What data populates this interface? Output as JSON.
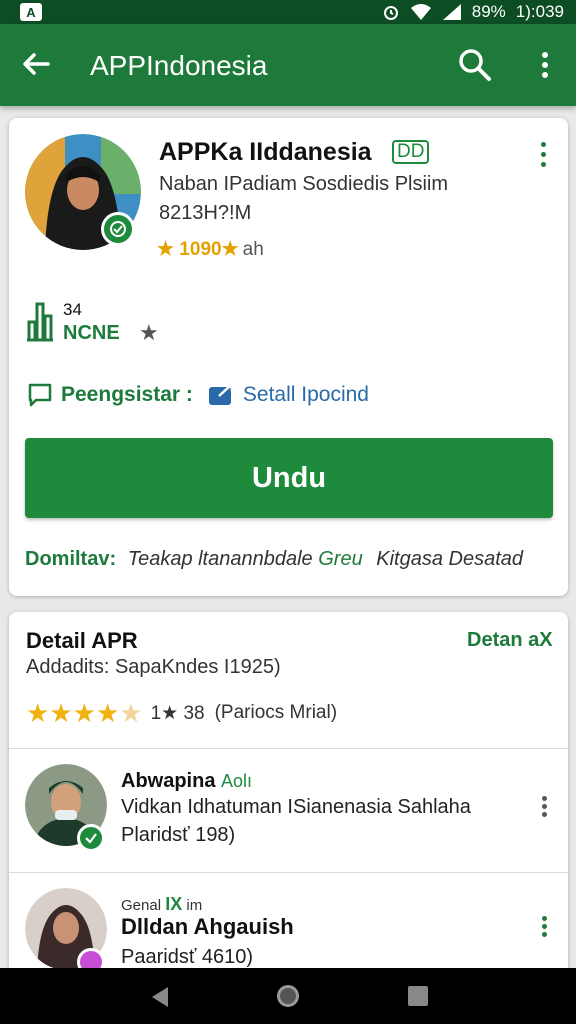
{
  "status_bar": {
    "app_icon": "A",
    "battery": "89%",
    "time": "1):039",
    "icons": [
      "alarm-icon",
      "wifi-icon",
      "signal-icon",
      "battery-icon"
    ]
  },
  "app_bar": {
    "title": "APPIndonesia",
    "icons": [
      "back-arrow-icon",
      "search-icon",
      "more-vert-icon"
    ]
  },
  "app_card": {
    "title": "APPKa IIddanesia",
    "badge": "DD",
    "subtitle": "Naban IPadiam Sosdiedis Plsiim",
    "code": "8213H?!M",
    "rating_text": "★ 1090★",
    "rating_suffix": "ah",
    "metric_number": "34",
    "metric_label": "NCNE",
    "register_label": "Peengsistar :",
    "register_value": "Setall Ipocind",
    "install_label": "Undu",
    "info_key": "Domiltav:",
    "info_value_1": "Teakap ltanannbdale",
    "info_value_2": "Greu",
    "info_value_3": "Kitgasa Desatad",
    "colors": {
      "primary": "#1d8a3c",
      "link": "#2a6aa8",
      "rating": "#e5a100"
    }
  },
  "detail_card": {
    "title": "Detail APR",
    "link": "Detan aX",
    "subtitle": "Addadits: SapaKndes I1925)",
    "rating": {
      "value": 4.5,
      "max": 5
    },
    "rating_count": "1★ 38",
    "rating_extra": "(Pariocs Mrial)"
  },
  "reviews": [
    {
      "name": "Abwapina",
      "tag": "Aolı",
      "text": "Vidkan Idhatuman ISianenasia Sahlaha",
      "date": "Plaridsť 198)"
    },
    {
      "heading": "Genal",
      "heading_tag": "IX",
      "heading_suffix": "im",
      "name": "Dlldan Ahgauish",
      "date": "Paaridsť 4610)"
    }
  ]
}
